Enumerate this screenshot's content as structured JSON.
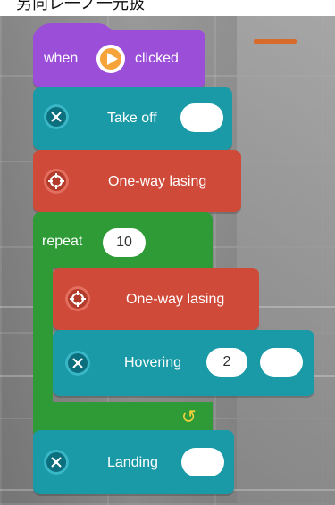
{
  "header": {
    "text": "另向レ一ノ一元扱"
  },
  "blocks": {
    "event": {
      "prefix": "when",
      "suffix": "clicked"
    },
    "takeoff": {
      "label": "Take off"
    },
    "lasing1": {
      "label": "One-way lasing"
    },
    "repeat": {
      "label": "repeat",
      "count": "10"
    },
    "lasing2": {
      "label": "One-way lasing"
    },
    "hover": {
      "label": "Hovering",
      "value": "2"
    },
    "landing": {
      "label": "Landing"
    }
  },
  "colors": {
    "event": "#9b4fd9",
    "action_teal": "#1a9aa6",
    "action_red": "#d04a3a",
    "control_green": "#2e9b36",
    "accent_orange": "#d86a2a"
  },
  "icons": {
    "event": "play-icon",
    "takeoff": "drone-icon",
    "lasing": "target-icon",
    "hover": "drone-icon",
    "landing": "drone-icon",
    "loop": "loop-arrow-icon"
  }
}
